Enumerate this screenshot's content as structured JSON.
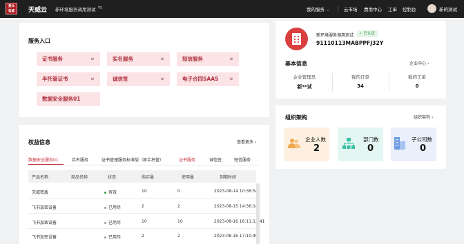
{
  "header": {
    "logo_line1": "贵众",
    "logo_line2": "信威",
    "brand": "天威云",
    "project": "新环境服务调用测试",
    "nav": [
      "我的服务",
      "云市场",
      "费用中心",
      "工单",
      "控制台"
    ],
    "user": "新的测试"
  },
  "service_entry": {
    "title": "服务入口",
    "items": [
      "证书服务",
      "实名服务",
      "短信服务",
      "半托管证书",
      "诚信签",
      "电子合同SAAS",
      "数据安全服务01"
    ]
  },
  "equity": {
    "title": "权益信息",
    "more": "查看更多",
    "tabs": [
      "数据安全服务01",
      "实名服务",
      "证书管理服务标准版（原半托管）",
      "证书服务",
      "诚信签",
      "短信服务"
    ],
    "columns": [
      "产品名称",
      "商品名称",
      "状态",
      "购买量",
      "使用量",
      "到期时间"
    ],
    "rows": [
      {
        "product": "天威密盾",
        "goods": "",
        "status": "有效",
        "status_color": "#2e9a43",
        "bought": "10",
        "used": "0",
        "expire": "2023-08-14 10:36:54"
      },
      {
        "product": "飞书加密设备",
        "goods": "",
        "status": "已用尽",
        "status_color": "#999999",
        "bought": "2",
        "used": "2",
        "expire": "2023-08-15 14:36:14"
      },
      {
        "product": "飞书加密设备",
        "goods": "",
        "status": "已用尽",
        "status_color": "#999999",
        "bought": "10",
        "used": "10",
        "expire": "2023-08-16 16:11:12:41"
      },
      {
        "product": "飞书加密设备",
        "goods": "",
        "status": "已用尽",
        "status_color": "#999999",
        "bought": "2",
        "used": "2",
        "expire": "2023-08-16 17:10:40"
      }
    ]
  },
  "company": {
    "name": "新环境服务调用测试",
    "verified": "已认证",
    "code": "91110113MABPPFJ32Y",
    "basic_title": "基本信息",
    "center_link": "企业中心",
    "stats": [
      {
        "label": "企业管理员",
        "value": "新**试"
      },
      {
        "label": "我的订单",
        "value": "34"
      },
      {
        "label": "我的工单",
        "value": "0"
      }
    ]
  },
  "org": {
    "title": "组织架构",
    "link": "组织架构",
    "cards": [
      {
        "label": "企业人数",
        "value": "2",
        "bg": "#fdf0e1",
        "icon_color": "#f0a84e"
      },
      {
        "label": "部门数",
        "value": "0",
        "bg": "#e4f6f2",
        "icon_color": "#3cbfa5"
      },
      {
        "label": "子公司数",
        "value": "0",
        "bg": "#e9f0fb",
        "icon_color": "#6c9be0"
      }
    ]
  }
}
